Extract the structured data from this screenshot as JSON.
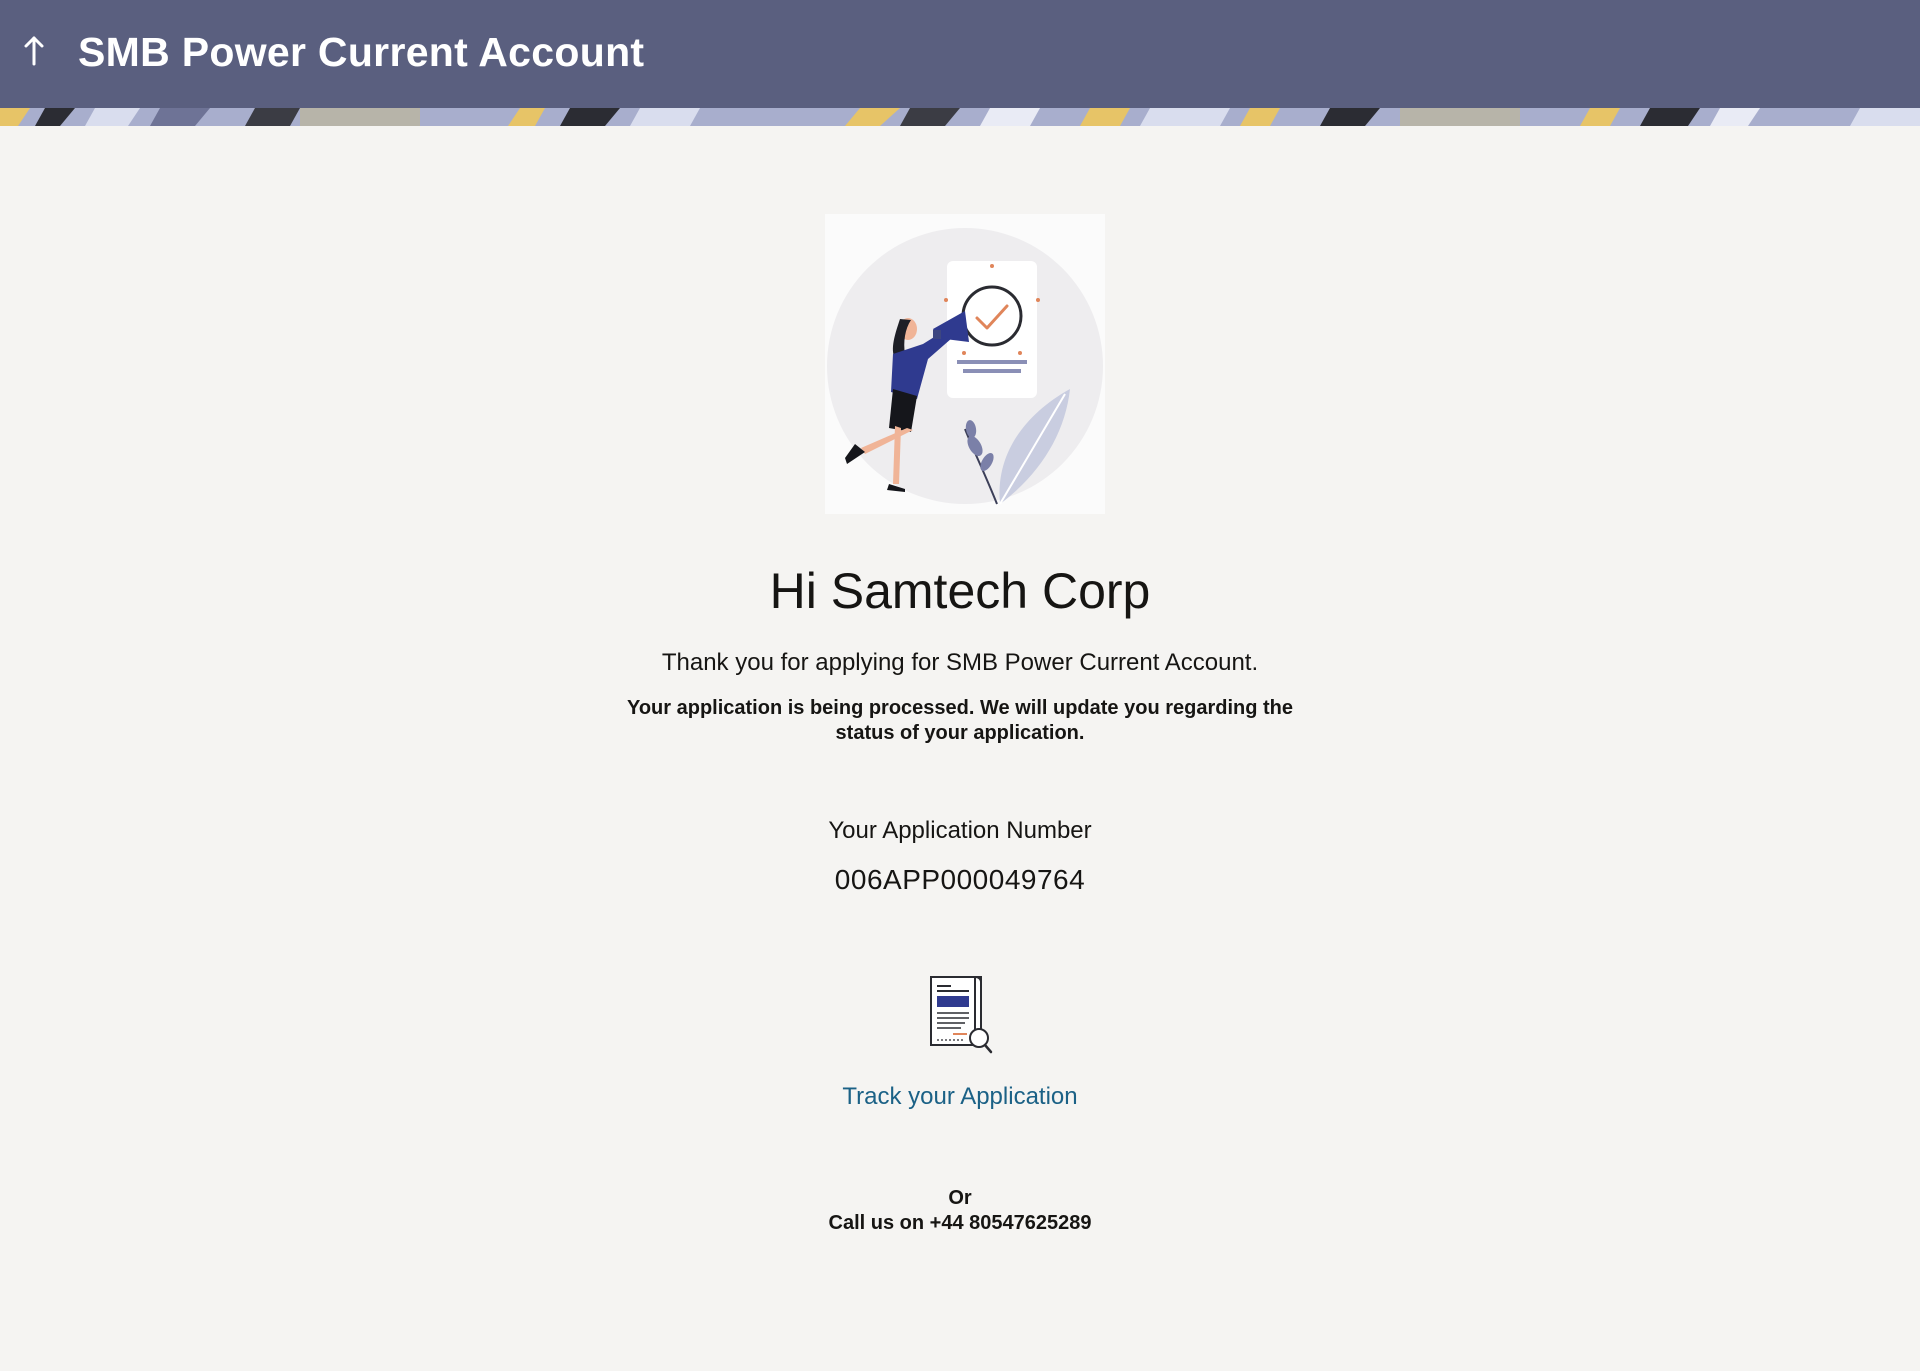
{
  "header": {
    "title": "SMB Power Current Account",
    "back_icon": "arrow-up-icon",
    "background_color": "#5a5f7f"
  },
  "confirmation": {
    "illustration": "woman-megaphone-checkmark-illustration",
    "greeting": "Hi Samtech Corp",
    "thanks_message": "Thank you for applying for SMB Power Current Account.",
    "processing_message": "Your application is being processed. We will update you regarding the status of your application.",
    "application_number_label": "Your Application Number",
    "application_number": "006APP000049764"
  },
  "tracking": {
    "icon": "document-search-icon",
    "link_label": "Track your Application",
    "link_color": "#1b6186"
  },
  "contact": {
    "or_label": "Or",
    "call_text": "Call us on +44 80547625289"
  }
}
